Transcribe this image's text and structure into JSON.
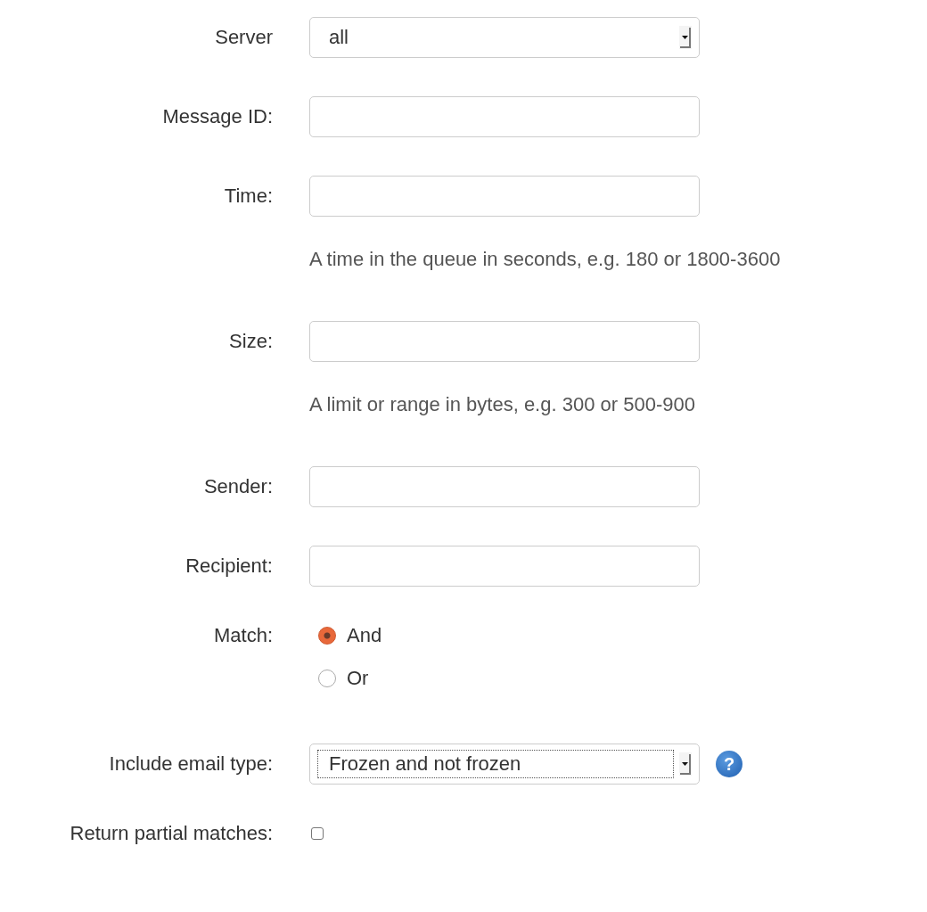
{
  "fields": [
    {
      "kind": "select",
      "label": "Server",
      "value": "all",
      "focused": false
    },
    {
      "kind": "text",
      "label": "Message ID:"
    },
    {
      "kind": "text",
      "label": "Time:",
      "hint": "A time in the queue in seconds, e.g. 180 or 1800-3600"
    },
    {
      "kind": "text",
      "label": "Size:",
      "hint": "A limit or range in bytes, e.g. 300 or 500-900"
    },
    {
      "kind": "text",
      "label": "Sender:"
    },
    {
      "kind": "text",
      "label": "Recipient:"
    },
    {
      "kind": "radio",
      "label": "Match:",
      "options": [
        {
          "label": "And",
          "selected": true
        },
        {
          "label": "Or",
          "selected": false
        }
      ]
    },
    {
      "kind": "select",
      "label": "Include email type:",
      "value": "Frozen and not frozen",
      "focused": true,
      "help": "?"
    },
    {
      "kind": "checkbox",
      "label": "Return partial matches:",
      "checked": false
    }
  ]
}
